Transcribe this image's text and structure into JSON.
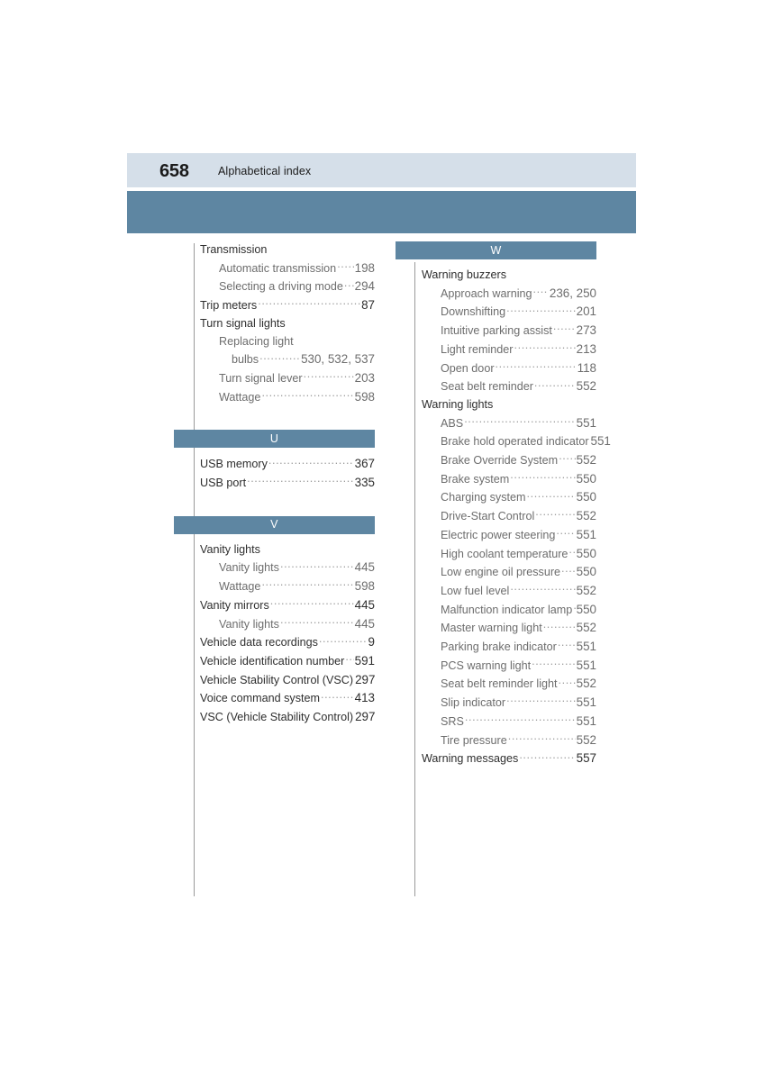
{
  "header": {
    "page_number": "658",
    "title": "Alphabetical index"
  },
  "columns": [
    {
      "name": "left-column",
      "blocks": [
        {
          "type": "entries",
          "items": [
            {
              "level": 0,
              "label": "Transmission",
              "page": "",
              "leader": false
            },
            {
              "level": 1,
              "label": "Automatic transmission",
              "page": "198",
              "leader": true
            },
            {
              "level": 1,
              "label": "Selecting a driving mode",
              "page": "294",
              "leader": true
            },
            {
              "level": 0,
              "label": "Trip meters",
              "page": "87",
              "leader": true
            },
            {
              "level": 0,
              "label": "Turn signal lights",
              "page": "",
              "leader": false
            },
            {
              "level": 1,
              "label": "Replacing light",
              "page": "",
              "leader": false
            },
            {
              "level": 2,
              "label": "bulbs",
              "page": "530, 532, 537",
              "leader": true
            },
            {
              "level": 1,
              "label": "Turn signal lever",
              "page": "203",
              "leader": true
            },
            {
              "level": 1,
              "label": "Wattage",
              "page": "598",
              "leader": true
            }
          ]
        },
        {
          "type": "letter",
          "letter": "U",
          "spaced_top": true,
          "items": [
            {
              "level": 0,
              "label": "USB memory",
              "page": "367",
              "leader": true
            },
            {
              "level": 0,
              "label": "USB port",
              "page": "335",
              "leader": true
            }
          ]
        },
        {
          "type": "letter",
          "letter": "V",
          "spaced_top": true,
          "items": [
            {
              "level": 0,
              "label": "Vanity lights",
              "page": "",
              "leader": false
            },
            {
              "level": 1,
              "label": "Vanity lights",
              "page": "445",
              "leader": true
            },
            {
              "level": 1,
              "label": "Wattage",
              "page": "598",
              "leader": true
            },
            {
              "level": 0,
              "label": "Vanity mirrors",
              "page": "445",
              "leader": true
            },
            {
              "level": 1,
              "label": "Vanity lights",
              "page": "445",
              "leader": true
            },
            {
              "level": 0,
              "label": "Vehicle data recordings",
              "page": "9",
              "leader": true
            },
            {
              "level": 0,
              "label": "Vehicle identification number",
              "page": "591",
              "leader": true
            },
            {
              "level": 0,
              "label": "Vehicle Stability Control (VSC)",
              "page": "297",
              "leader": true
            },
            {
              "level": 0,
              "label": "Voice command system",
              "page": "413",
              "leader": true
            },
            {
              "level": 0,
              "label": "VSC (Vehicle Stability Control)",
              "page": "297",
              "leader": true
            }
          ]
        }
      ]
    },
    {
      "name": "right-column",
      "blocks": [
        {
          "type": "letter",
          "letter": "W",
          "spaced_top": false,
          "items": [
            {
              "level": 0,
              "label": "Warning buzzers",
              "page": "",
              "leader": false
            },
            {
              "level": 1,
              "label": "Approach warning",
              "page": "236, 250",
              "leader": true
            },
            {
              "level": 1,
              "label": "Downshifting",
              "page": "201",
              "leader": true
            },
            {
              "level": 1,
              "label": "Intuitive parking assist",
              "page": "273",
              "leader": true
            },
            {
              "level": 1,
              "label": "Light reminder",
              "page": "213",
              "leader": true
            },
            {
              "level": 1,
              "label": "Open door",
              "page": "118",
              "leader": true
            },
            {
              "level": 1,
              "label": "Seat belt reminder",
              "page": "552",
              "leader": true
            },
            {
              "level": 0,
              "label": "Warning lights",
              "page": "",
              "leader": false
            },
            {
              "level": 1,
              "label": "ABS",
              "page": "551",
              "leader": true
            },
            {
              "level": 1,
              "label": "Brake hold operated indicator",
              "page": "551",
              "leader": true
            },
            {
              "level": 1,
              "label": "Brake Override System",
              "page": "552",
              "leader": true
            },
            {
              "level": 1,
              "label": "Brake system",
              "page": "550",
              "leader": true
            },
            {
              "level": 1,
              "label": "Charging system",
              "page": "550",
              "leader": true
            },
            {
              "level": 1,
              "label": "Drive-Start Control",
              "page": "552",
              "leader": true
            },
            {
              "level": 1,
              "label": "Electric power steering",
              "page": "551",
              "leader": true
            },
            {
              "level": 1,
              "label": "High coolant temperature",
              "page": "550",
              "leader": true
            },
            {
              "level": 1,
              "label": "Low engine oil pressure",
              "page": "550",
              "leader": true
            },
            {
              "level": 1,
              "label": "Low fuel level",
              "page": "552",
              "leader": true
            },
            {
              "level": 1,
              "label": "Malfunction indicator lamp",
              "page": "550",
              "leader": true
            },
            {
              "level": 1,
              "label": "Master warning light",
              "page": "552",
              "leader": true
            },
            {
              "level": 1,
              "label": "Parking brake indicator",
              "page": "551",
              "leader": true
            },
            {
              "level": 1,
              "label": "PCS warning light",
              "page": "551",
              "leader": true
            },
            {
              "level": 1,
              "label": "Seat belt reminder light",
              "page": "552",
              "leader": true
            },
            {
              "level": 1,
              "label": "Slip indicator",
              "page": "551",
              "leader": true
            },
            {
              "level": 1,
              "label": "SRS",
              "page": "551",
              "leader": true
            },
            {
              "level": 1,
              "label": "Tire pressure",
              "page": "552",
              "leader": true
            },
            {
              "level": 0,
              "label": "Warning messages",
              "page": "557",
              "leader": true
            }
          ]
        }
      ]
    }
  ],
  "colors": {
    "header_light_band": "#d5dfe9",
    "header_dark_band": "#5e86a2",
    "letter_band": "#5e86a2",
    "main_entry_text": "#2e2e2e",
    "sub_entry_text": "#6d6d6d",
    "leader_dots": "#9b9b9b",
    "column_rule": "#9a9a9a"
  }
}
